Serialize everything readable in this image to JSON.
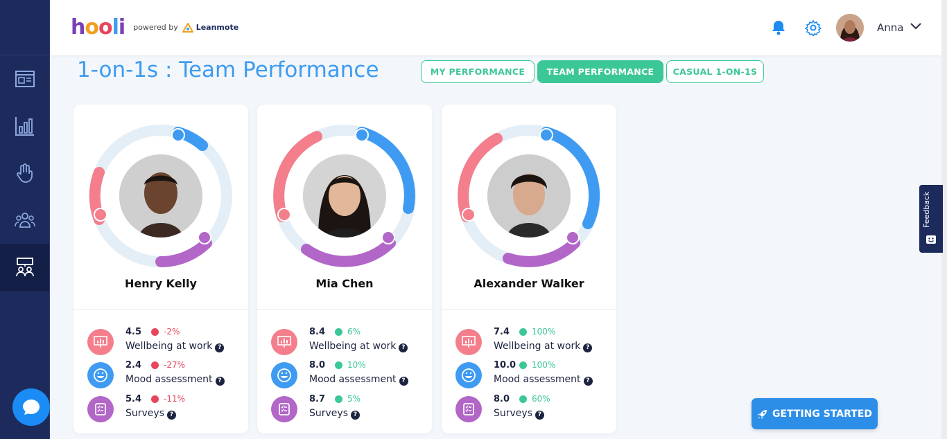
{
  "header": {
    "logo_text": "hooli",
    "powered_by": "powered by",
    "partner": "Leanmote",
    "username": "Anna"
  },
  "page": {
    "title": "1-on-1s : Team Performance",
    "tabs": [
      {
        "label": "MY PERFORMANCE",
        "active": false
      },
      {
        "label": "TEAM PERFORMANCE",
        "active": true
      },
      {
        "label": "CASUAL 1-ON-1S",
        "active": false
      }
    ]
  },
  "cards": [
    {
      "name": "Henry Kelly",
      "metrics": [
        {
          "value": "4.5",
          "change": "-2%",
          "trend": "down",
          "label": "Wellbeing at work"
        },
        {
          "value": "2.4",
          "change": "-27%",
          "trend": "down",
          "label": "Mood assessment"
        },
        {
          "value": "5.4",
          "change": "-11%",
          "trend": "down",
          "label": "Surveys"
        }
      ]
    },
    {
      "name": "Mia Chen",
      "metrics": [
        {
          "value": "8.4",
          "change": "6%",
          "trend": "up",
          "label": "Wellbeing at work"
        },
        {
          "value": "8.0",
          "change": "10%",
          "trend": "up",
          "label": "Mood assessment"
        },
        {
          "value": "8.7",
          "change": "5%",
          "trend": "up",
          "label": "Surveys"
        }
      ]
    },
    {
      "name": "Alexander Walker",
      "metrics": [
        {
          "value": "7.4",
          "change": "100%",
          "trend": "up",
          "label": "Wellbeing at work"
        },
        {
          "value": "10.0",
          "change": "100%",
          "trend": "up",
          "label": "Mood assessment"
        },
        {
          "value": "8.0",
          "change": "60%",
          "trend": "up",
          "label": "Surveys"
        }
      ]
    }
  ],
  "feedback_label": "Feedback",
  "getting_started_label": "GETTING STARTED",
  "colors": {
    "sidebar": "#1c2b5c",
    "accent_blue": "#3d9bf0",
    "accent_green": "#3cc796",
    "wellbeing": "#f47e8c",
    "mood": "#3f9bf2",
    "surveys": "#b266c8",
    "down": "#e8455c",
    "up": "#3cc796"
  }
}
